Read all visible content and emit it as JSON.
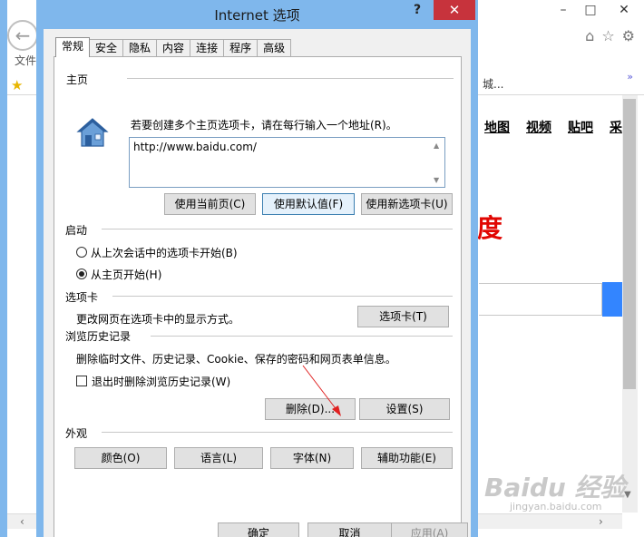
{
  "browser": {
    "menu_text": "文件",
    "favorites_text": "城...",
    "nav_links": [
      "地图",
      "视频",
      "贴吧"
    ],
    "partial_nav": "采",
    "red_logo": "度",
    "watermark": "Baidu 经验",
    "watermark_url": "jingyan.baidu.com",
    "window_controls": [
      "–",
      "□",
      "✕"
    ],
    "icons": [
      "home-icon",
      "star-icon",
      "gear-icon"
    ]
  },
  "dialog": {
    "title": "Internet 选项",
    "help": "?",
    "close": "✕",
    "tabs": [
      "常规",
      "安全",
      "隐私",
      "内容",
      "连接",
      "程序",
      "高级"
    ],
    "active_tab": "常规",
    "homepage": {
      "title": "主页",
      "description": "若要创建多个主页选项卡，请在每行输入一个地址(R)。",
      "url": "http://www.baidu.com/",
      "btn_current": "使用当前页(C)",
      "btn_default": "使用默认值(F)",
      "btn_new_tab": "使用新选项卡(U)"
    },
    "startup": {
      "title": "启动",
      "option1": "从上次会话中的选项卡开始(B)",
      "option2": "从主页开始(H)",
      "selected": "从主页开始(H)"
    },
    "tabs_section": {
      "title": "选项卡",
      "description": "更改网页在选项卡中的显示方式。",
      "btn_tabs": "选项卡(T)"
    },
    "history": {
      "title": "浏览历史记录",
      "description": "删除临时文件、历史记录、Cookie、保存的密码和网页表单信息。",
      "checkbox_label": "退出时删除浏览历史记录(W)",
      "checkbox_checked": false,
      "btn_delete": "删除(D)...",
      "btn_settings": "设置(S)"
    },
    "appearance": {
      "title": "外观",
      "btn_colors": "颜色(O)",
      "btn_languages": "语言(L)",
      "btn_fonts": "字体(N)",
      "btn_accessibility": "辅助功能(E)"
    },
    "footer": {
      "btn_ok": "确定",
      "btn_cancel": "取消",
      "btn_apply": "应用(A)"
    }
  },
  "colors": {
    "frame": "#7fb7ec",
    "close_button": "#c7333c",
    "annotation_arrow": "#e02020",
    "search_button": "#3385ff"
  }
}
